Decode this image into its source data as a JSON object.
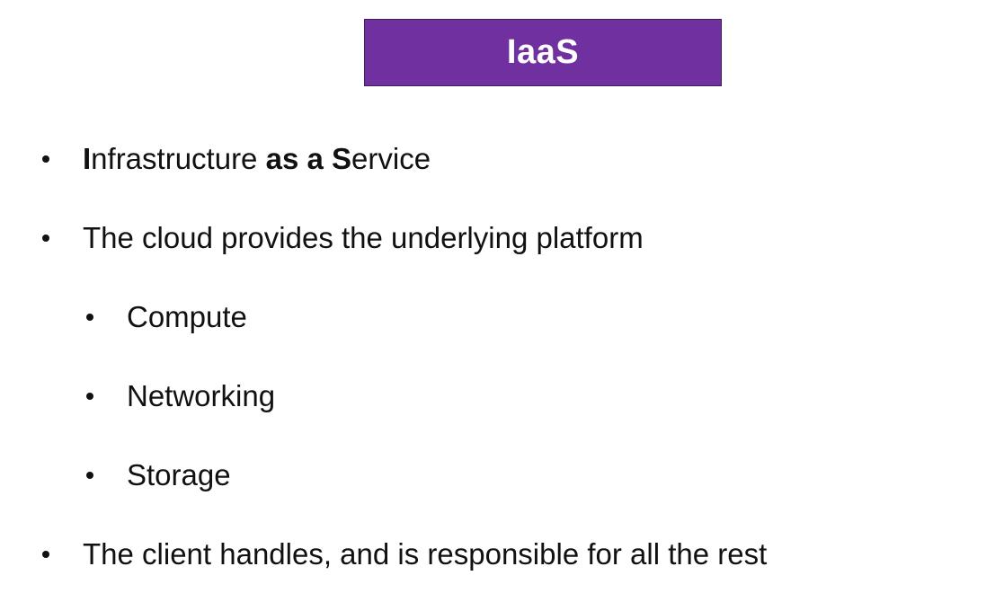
{
  "slide": {
    "title": "IaaS",
    "title_color": "#7030a0",
    "bullets": [
      {
        "level": 1,
        "parts": [
          {
            "text": "I",
            "bold": true
          },
          {
            "text": "nfrastructure ",
            "bold": false
          },
          {
            "text": "as a ",
            "bold": true
          },
          {
            "text": "S",
            "bold": true
          },
          {
            "text": "ervice",
            "bold": false
          }
        ]
      },
      {
        "level": 1,
        "text": "The cloud provides the underlying platform"
      },
      {
        "level": 2,
        "text": "Compute"
      },
      {
        "level": 2,
        "text": "Networking"
      },
      {
        "level": 2,
        "text": "Storage"
      },
      {
        "level": 1,
        "text": "The client handles, and is responsible for all the rest"
      }
    ]
  }
}
